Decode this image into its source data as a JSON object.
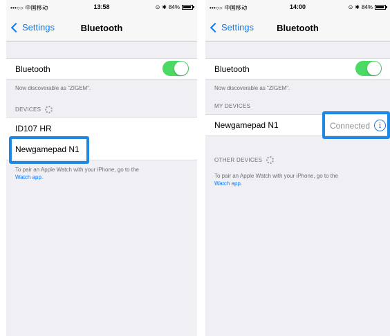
{
  "left": {
    "status": {
      "carrier": "•••○○ 中国移动",
      "time": "13:58",
      "battery": "84%"
    },
    "nav": {
      "back_label": "Settings",
      "title": "Bluetooth"
    },
    "bluetooth_label": "Bluetooth",
    "discoverable": "Now discoverable as \"ZIGEM\".",
    "devices_header": "DEVICES",
    "devices": [
      "ID107 HR",
      "Newgamepad N1"
    ],
    "footer_text": "To pair an Apple Watch with your iPhone, go to the",
    "footer_link": "Watch app."
  },
  "right": {
    "status": {
      "carrier": "•••○○ 中国移动",
      "time": "14:00",
      "battery": "84%"
    },
    "nav": {
      "back_label": "Settings",
      "title": "Bluetooth"
    },
    "bluetooth_label": "Bluetooth",
    "discoverable": "Now discoverable as \"ZIGEM\".",
    "my_devices_header": "MY DEVICES",
    "my_device": {
      "name": "Newgamepad N1",
      "status": "Connected"
    },
    "other_devices_header": "OTHER DEVICES",
    "footer_text": "To pair an Apple Watch with your iPhone, go to the",
    "footer_link": "Watch app."
  },
  "colors": {
    "accent": "#0a7aff",
    "toggle_on": "#4cd964",
    "highlight": "#1e88e5"
  }
}
